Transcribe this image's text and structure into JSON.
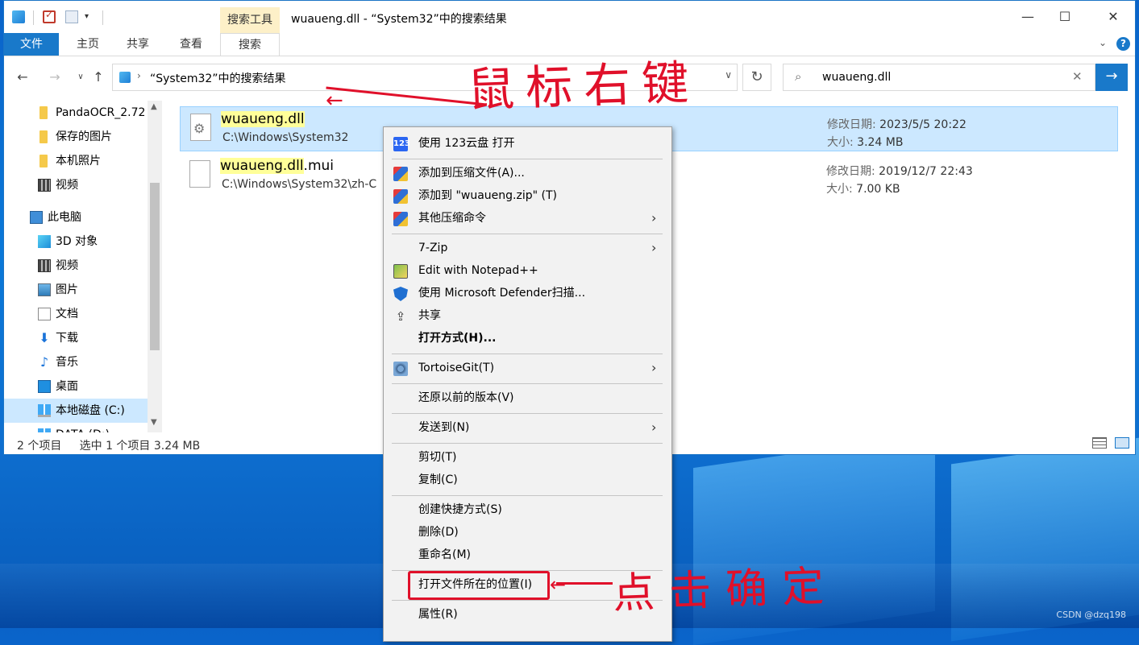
{
  "window": {
    "title": "wuaueng.dll - “System32”中的搜索结果",
    "context_tab_header": "搜索工具",
    "controls": {
      "minimize": "—",
      "maximize": "☐",
      "close": "✕"
    }
  },
  "ribbon": {
    "tabs": [
      "文件",
      "主页",
      "共享",
      "查看",
      "搜索"
    ],
    "active_tab": "搜索",
    "collapse": "⌄",
    "help": "?"
  },
  "nav": {
    "back": "←",
    "forward": "→",
    "recent": "∨",
    "up": "↑",
    "breadcrumb_sep": "›",
    "address": "“System32”中的搜索结果",
    "address_dropdown": "∨",
    "refresh": "↻",
    "search_value": "wuaueng.dll",
    "search_icon": "⌕",
    "search_clear": "✕",
    "search_go": "→"
  },
  "sidebar": {
    "items": [
      {
        "label": "PandaOCR_2.72",
        "icon": "folder-icon"
      },
      {
        "label": "保存的图片",
        "icon": "folder-icon"
      },
      {
        "label": "本机照片",
        "icon": "folder-icon"
      },
      {
        "label": "视频",
        "icon": "video-icon"
      },
      {
        "label": "此电脑",
        "icon": "pc-icon"
      },
      {
        "label": "3D 对象",
        "icon": "cube-icon"
      },
      {
        "label": "视频",
        "icon": "video-icon"
      },
      {
        "label": "图片",
        "icon": "picture-icon"
      },
      {
        "label": "文档",
        "icon": "document-icon"
      },
      {
        "label": "下载",
        "icon": "download-icon",
        "glyph": "⬇"
      },
      {
        "label": "音乐",
        "icon": "music-icon",
        "glyph": "♪"
      },
      {
        "label": "桌面",
        "icon": "desktop-icon"
      },
      {
        "label": "本地磁盘 (C:)",
        "icon": "drive-icon"
      },
      {
        "label": "DATA (D:)",
        "icon": "drive-icon"
      }
    ],
    "scroll_up": "▲",
    "scroll_down": "▼"
  },
  "results": [
    {
      "name_highlight": "wuaueng.dll",
      "name_rest": "",
      "path": "C:\\Windows\\System32",
      "modified_label": "修改日期:",
      "modified": "2023/5/5 20:22",
      "size_label": "大小:",
      "size": "3.24 MB",
      "icon_glyph": "⚙"
    },
    {
      "name_highlight": "wuaueng.dll",
      "name_rest": ".mui",
      "path": "C:\\Windows\\System32\\zh-C",
      "modified_label": "修改日期:",
      "modified": "2019/12/7 22:43",
      "size_label": "大小:",
      "size": "7.00 KB"
    }
  ],
  "status": {
    "count": "2 个项目",
    "selection": "选中 1 个项目  3.24 MB"
  },
  "context_menu": {
    "items": [
      {
        "label": "使用 123云盘 打开",
        "icon": "123",
        "arrow": ""
      },
      {
        "label": "添加到压缩文件(A)...",
        "icon": "",
        "arrow": ""
      },
      {
        "label": "添加到 \"wuaueng.zip\" (T)",
        "icon": "",
        "arrow": ""
      },
      {
        "label": "其他压缩命令",
        "icon": "",
        "arrow": "›"
      },
      {
        "label": "7-Zip",
        "icon": "",
        "arrow": "›"
      },
      {
        "label": "Edit with Notepad++",
        "icon": "",
        "arrow": ""
      },
      {
        "label": "使用 Microsoft Defender扫描...",
        "icon": "",
        "arrow": ""
      },
      {
        "label": "共享",
        "icon": "⇪",
        "arrow": ""
      },
      {
        "label": "打开方式(H)...",
        "icon": "",
        "arrow": ""
      },
      {
        "label": "TortoiseGit(T)",
        "icon": "",
        "arrow": "›"
      },
      {
        "label": "还原以前的版本(V)",
        "icon": "",
        "arrow": ""
      },
      {
        "label": "发送到(N)",
        "icon": "",
        "arrow": "›"
      },
      {
        "label": "剪切(T)",
        "icon": "",
        "arrow": ""
      },
      {
        "label": "复制(C)",
        "icon": "",
        "arrow": ""
      },
      {
        "label": "创建快捷方式(S)",
        "icon": "",
        "arrow": ""
      },
      {
        "label": "删除(D)",
        "icon": "",
        "arrow": ""
      },
      {
        "label": "重命名(M)",
        "icon": "",
        "arrow": ""
      },
      {
        "label": "打开文件所在的位置(I)",
        "icon": "",
        "arrow": ""
      },
      {
        "label": "属性(R)",
        "icon": "",
        "arrow": ""
      }
    ]
  },
  "annotations": {
    "right_click": "鼠标右键",
    "click_confirm": "点击确定",
    "arrow": "←"
  },
  "watermark": "CSDN @dzq198"
}
